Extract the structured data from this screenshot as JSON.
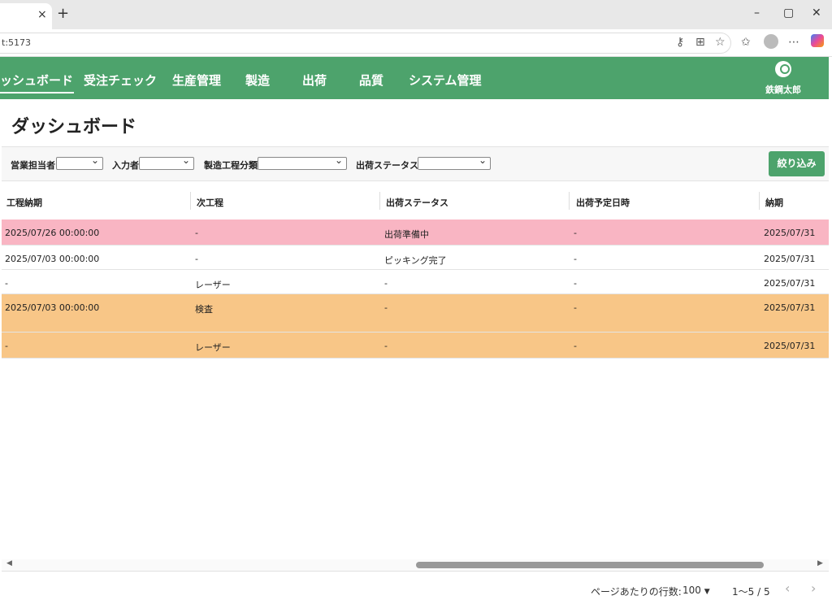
{
  "browser": {
    "tab_close": "×",
    "new_tab": "+",
    "window_controls": [
      "–",
      "▢",
      "✕"
    ],
    "url": "t:5173",
    "toolbar_icons": [
      "key-icon",
      "apps-icon",
      "star-icon",
      "favorites-icon",
      "profile-icon",
      "more-icon",
      "copilot-icon"
    ]
  },
  "nav": {
    "items": [
      "ッシュボード",
      "受注チェック",
      "生産管理",
      "製造",
      "出荷",
      "品質",
      "システム管理"
    ],
    "user_name": "鉄鋼太郎"
  },
  "page": {
    "title": "ダッシュボード"
  },
  "filters": {
    "labels": [
      "営業担当者",
      "入力者",
      "製造工程分類",
      "出荷ステータス"
    ],
    "values": [
      "",
      "",
      "",
      ""
    ],
    "submit_label": "絞り込み"
  },
  "table": {
    "headers": [
      "工程納期",
      "次工程",
      "出荷ステータス",
      "出荷予定日時",
      "納期"
    ],
    "rows": [
      {
        "cells": [
          "2025/07/26 00:00:00",
          "-",
          "出荷準備中",
          "-",
          "2025/07/31"
        ],
        "bg": "#f9b5c3"
      },
      {
        "cells": [
          "2025/07/03 00:00:00",
          "-",
          "ピッキング完了",
          "-",
          "2025/07/31"
        ],
        "bg": "#ffffff"
      },
      {
        "cells": [
          "-",
          "レーザー",
          "-",
          "-",
          "2025/07/31"
        ],
        "bg": "#ffffff"
      },
      {
        "cells": [
          "2025/07/03 00:00:00",
          "検査",
          "-",
          "-",
          "2025/07/31"
        ],
        "bg": "#f8c687"
      },
      {
        "cells": [
          "-",
          "レーザー",
          "-",
          "-",
          "2025/07/31"
        ],
        "bg": "#f8c687"
      }
    ]
  },
  "footer": {
    "rows_per_page_label": "ページあたりの行数:",
    "rows_per_page_value": "100",
    "range": "1〜5 / 5",
    "prev": "‹",
    "next": "›"
  },
  "colors": {
    "brand": "#4da36c",
    "row_pink": "#f9b5c3",
    "row_orange": "#f8c687"
  }
}
